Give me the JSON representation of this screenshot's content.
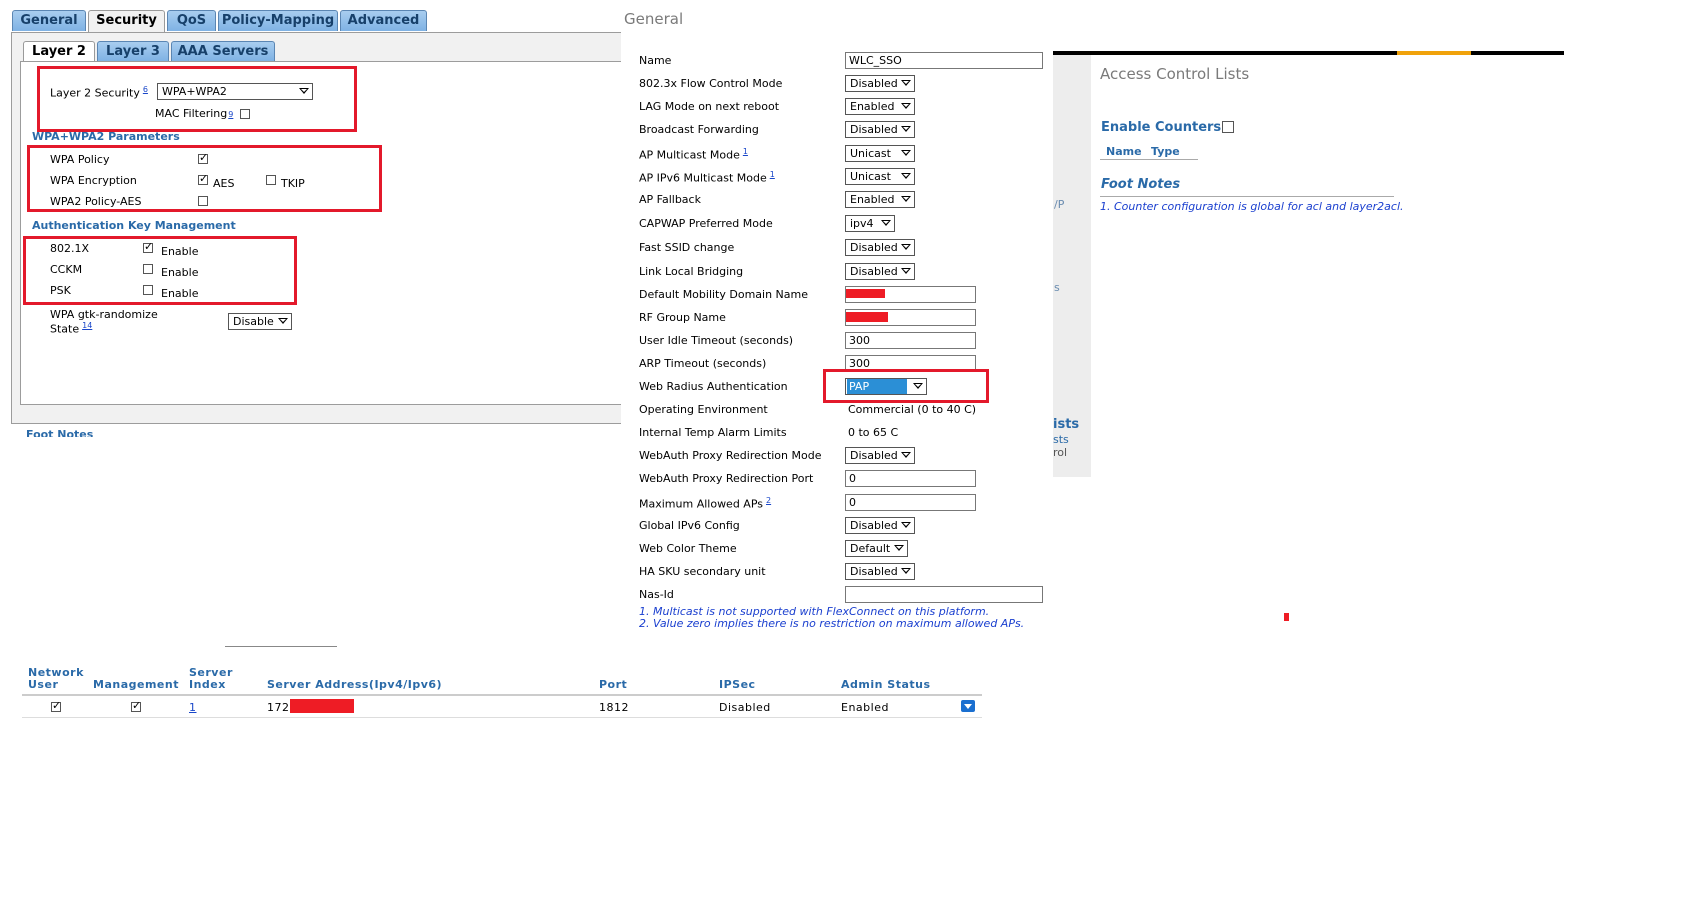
{
  "security": {
    "tabs": [
      "General",
      "Security",
      "QoS",
      "Policy-Mapping",
      "Advanced"
    ],
    "active_tab": "Security",
    "subtabs": [
      "Layer 2",
      "Layer 3",
      "AAA Servers"
    ],
    "active_subtab": "Layer 2",
    "layer2_security_label": "Layer 2 Security",
    "layer2_security_sup": "6",
    "layer2_security_value": "WPA+WPA2",
    "mac_filtering_label": "MAC Filtering",
    "mac_filtering_sup": "9",
    "mac_filtering_checked": false,
    "wpa_params_heading": "WPA+WPA2 Parameters",
    "wpa_policy_label": "WPA Policy",
    "wpa_policy_checked": true,
    "wpa_encryption_label": "WPA Encryption",
    "aes_label": "AES",
    "aes_checked": true,
    "tkip_label": "TKIP",
    "tkip_checked": false,
    "wpa2_policy_label": "WPA2 Policy-AES",
    "wpa2_policy_checked": false,
    "akm_heading": "Authentication Key Management",
    "akm": [
      {
        "label": "802.1X",
        "checked": true,
        "option": "Enable"
      },
      {
        "label": "CCKM",
        "checked": false,
        "option": "Enable"
      },
      {
        "label": "PSK",
        "checked": false,
        "option": "Enable"
      }
    ],
    "gtk_label_line1": "WPA gtk-randomize",
    "gtk_label_line2": "State",
    "gtk_sup": "14",
    "gtk_value": "Disable",
    "highlight_color": "#e3192b"
  },
  "general": {
    "title": "General",
    "rows": [
      {
        "label": "Name",
        "type": "text",
        "value": "WLC_SSO"
      },
      {
        "label": "802.3x Flow Control Mode",
        "type": "select",
        "value": "Disabled"
      },
      {
        "label": "LAG Mode on next reboot",
        "type": "select",
        "value": "Enabled"
      },
      {
        "label": "Broadcast Forwarding",
        "type": "select",
        "value": "Disabled"
      },
      {
        "label": "AP Multicast Mode",
        "sup": "1",
        "type": "select",
        "value": "Unicast"
      },
      {
        "label": "AP IPv6 Multicast Mode",
        "sup": "1",
        "type": "select",
        "value": "Unicast"
      },
      {
        "label": "AP Fallback",
        "type": "select",
        "value": "Enabled"
      },
      {
        "label": "CAPWAP Preferred Mode",
        "type": "select",
        "value": "ipv4"
      },
      {
        "label": "Fast SSID change",
        "type": "select",
        "value": "Disabled"
      },
      {
        "label": "Link Local Bridging",
        "type": "select",
        "value": "Disabled"
      },
      {
        "label": "Default Mobility Domain Name",
        "type": "text",
        "value": "",
        "redacted": true
      },
      {
        "label": "RF Group Name",
        "type": "text",
        "value": "",
        "redacted": true
      },
      {
        "label": "User Idle Timeout (seconds)",
        "type": "text",
        "value": "300"
      },
      {
        "label": "ARP Timeout (seconds)",
        "type": "text",
        "value": "300"
      },
      {
        "label": "Web Radius Authentication",
        "type": "select",
        "value": "PAP",
        "highlight": true
      },
      {
        "label": "Operating Environment",
        "type": "static",
        "value": "Commercial (0 to 40 C)"
      },
      {
        "label": "Internal Temp Alarm Limits",
        "type": "static",
        "value": "0 to 65 C"
      },
      {
        "label": "WebAuth Proxy Redirection Mode",
        "type": "select",
        "value": "Disabled"
      },
      {
        "label": "WebAuth Proxy Redirection Port",
        "type": "text",
        "value": "0"
      },
      {
        "label": "Maximum Allowed APs",
        "sup": "2",
        "type": "text",
        "value": "0"
      },
      {
        "label": "Global IPv6 Config",
        "type": "select",
        "value": "Disabled"
      },
      {
        "label": "Web Color Theme",
        "type": "select",
        "value": "Default"
      },
      {
        "label": "HA SKU secondary unit",
        "type": "select",
        "value": "Disabled"
      },
      {
        "label": "Nas-Id",
        "type": "text",
        "value": ""
      }
    ],
    "notes": [
      "1. Multicast is not supported with FlexConnect on this platform.",
      "2. Value zero implies there is no restriction on maximum allowed APs."
    ],
    "selected_option_bg": "#2b8fd6"
  },
  "acl": {
    "title": "Access Control Lists",
    "enable_counters_label": "Enable Counters",
    "enable_counters_checked": false,
    "col_name": "Name",
    "col_type": "Type",
    "foot_notes_title": "Foot Notes",
    "foot_note": "1. Counter configuration is global for acl and layer2acl.",
    "bar_color": "#000000",
    "accent_color": "#f0a20b",
    "cut_fragments": [
      "/P",
      "s",
      "ists",
      "sts",
      "rol"
    ]
  },
  "radius": {
    "headers": {
      "network_user": [
        "Network",
        "User"
      ],
      "management": "Management",
      "server_index": [
        "Server",
        "Index"
      ],
      "server_address": "Server Address(Ipv4/Ipv6)",
      "port": "Port",
      "ipsec": "IPSec",
      "admin_status": "Admin Status"
    },
    "row": {
      "network_user_checked": true,
      "management_checked": true,
      "server_index": "1",
      "server_address_prefix": "172.",
      "port": "1812",
      "ipsec": "Disabled",
      "admin_status": "Enabled"
    },
    "cut_fragment": "Foot Notes"
  }
}
